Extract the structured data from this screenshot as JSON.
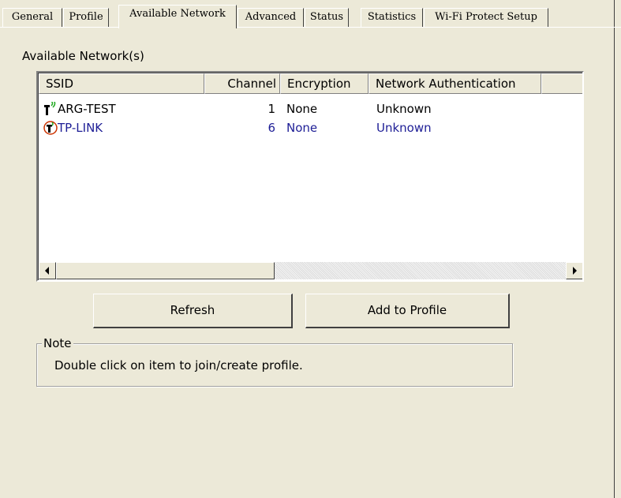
{
  "tabs": [
    {
      "label": "General"
    },
    {
      "label": "Profile"
    },
    {
      "label": "Available Network"
    },
    {
      "label": "Advanced"
    },
    {
      "label": "Status"
    },
    {
      "label": "Statistics"
    },
    {
      "label": "Wi-Fi Protect Setup"
    }
  ],
  "section": {
    "label": "Available Network(s)"
  },
  "list": {
    "columns": [
      "SSID",
      "Channel",
      "Encryption",
      "Network Authentication"
    ],
    "rows": [
      {
        "ssid": "ARG-TEST",
        "channel": "1",
        "encryption": "None",
        "auth": "Unknown",
        "icon": "wifi-signal-icon"
      },
      {
        "ssid": "TP-LINK",
        "channel": "6",
        "encryption": "None",
        "auth": "Unknown",
        "icon": "wifi-connected-icon"
      }
    ]
  },
  "buttons": {
    "refresh": "Refresh",
    "add_to_profile": "Add to Profile"
  },
  "note": {
    "title": "Note",
    "text": "Double click on item to join/create profile."
  },
  "colors": {
    "selected_text": "#1e1e96",
    "face": "#ece9d8",
    "signal_green": "#22aa22",
    "connected_ring": "#cc3300"
  }
}
